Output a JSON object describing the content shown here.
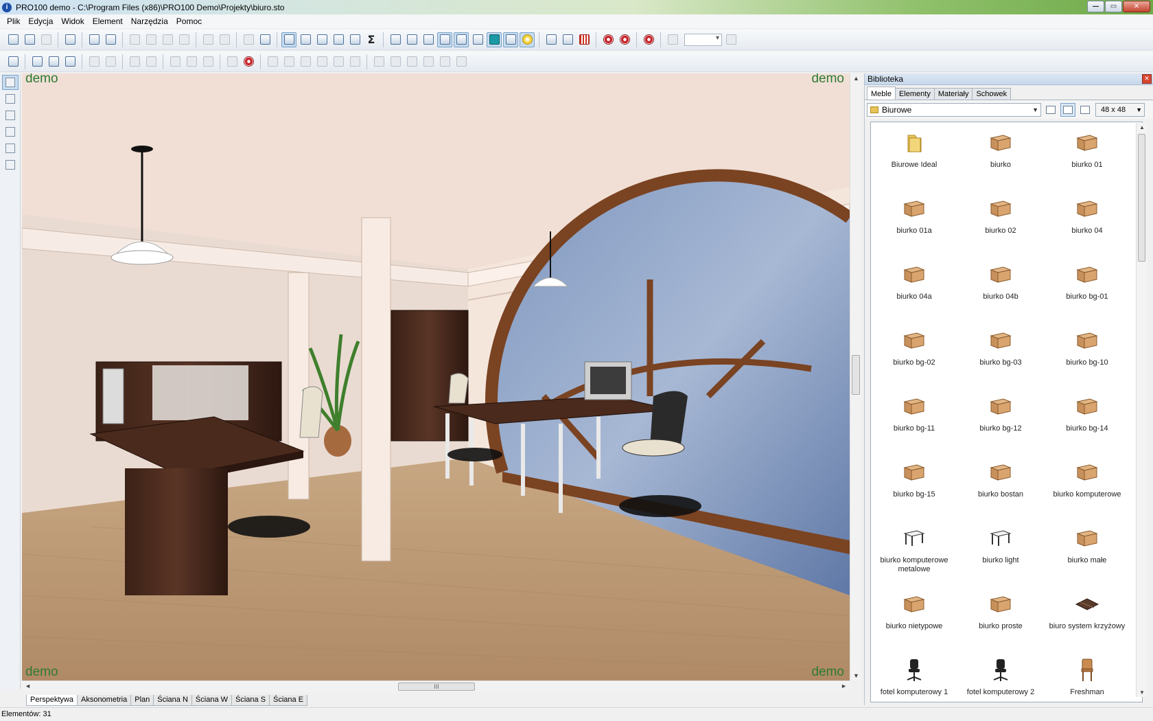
{
  "window": {
    "title": "PRO100 demo - C:\\Program Files (x86)\\PRO100 Demo\\Projekty\\biuro.sto",
    "app_icon_letter": "i",
    "controls": {
      "minimize": "—",
      "maximize": "▭",
      "close": "✕"
    }
  },
  "menu": [
    "Plik",
    "Edycja",
    "Widok",
    "Element",
    "Narzędzia",
    "Pomoc"
  ],
  "toolbar": {
    "sigma_label": "Σ"
  },
  "viewport": {
    "watermarks": [
      "demo",
      "demo",
      "demo",
      "demo"
    ],
    "scroll_grip": "III",
    "scroll_up": "▲",
    "scroll_down": "▼",
    "scroll_left": "◄",
    "scroll_right": "►"
  },
  "view_tabs": [
    {
      "label": "Perspektywa",
      "active": true
    },
    {
      "label": "Aksonometria",
      "active": false
    },
    {
      "label": "Plan",
      "active": false
    },
    {
      "label": "Ściana N",
      "active": false
    },
    {
      "label": "Ściana W",
      "active": false
    },
    {
      "label": "Ściana S",
      "active": false
    },
    {
      "label": "Ściana E",
      "active": false
    }
  ],
  "status": {
    "text": "Elementów: 31"
  },
  "library": {
    "title": "Biblioteka",
    "close": "✕",
    "tabs": [
      {
        "label": "Meble",
        "active": true
      },
      {
        "label": "Elementy",
        "active": false
      },
      {
        "label": "Materiały",
        "active": false
      },
      {
        "label": "Schowek",
        "active": false
      }
    ],
    "folder": "Biurowe",
    "thumb_size": "48 x 48",
    "dropdown_arrow": "▼",
    "items": [
      {
        "label": "Biurowe Ideal",
        "icon": "folder-icon"
      },
      {
        "label": "biurko",
        "icon": "desk-icon"
      },
      {
        "label": "biurko 01",
        "icon": "desk-icon"
      },
      {
        "label": "biurko 01a",
        "icon": "desk-icon"
      },
      {
        "label": "biurko 02",
        "icon": "desk-icon"
      },
      {
        "label": "biurko 04",
        "icon": "desk-icon"
      },
      {
        "label": "biurko 04a",
        "icon": "desk-icon"
      },
      {
        "label": "biurko 04b",
        "icon": "desk-icon"
      },
      {
        "label": "biurko bg-01",
        "icon": "desk-icon"
      },
      {
        "label": "biurko bg-02",
        "icon": "desk-icon"
      },
      {
        "label": "biurko bg-03",
        "icon": "desk-icon"
      },
      {
        "label": "biurko bg-10",
        "icon": "desk-icon"
      },
      {
        "label": "biurko bg-11",
        "icon": "desk-icon"
      },
      {
        "label": "biurko bg-12",
        "icon": "desk-icon"
      },
      {
        "label": "biurko bg-14",
        "icon": "desk-icon"
      },
      {
        "label": "biurko bg-15",
        "icon": "desk-icon"
      },
      {
        "label": "biurko bostan",
        "icon": "desk-icon"
      },
      {
        "label": "biurko komputerowe",
        "icon": "desk-icon"
      },
      {
        "label": "biurko komputerowe metalowe",
        "icon": "desk-metal-icon"
      },
      {
        "label": "biurko light",
        "icon": "desk-metal-icon"
      },
      {
        "label": "biurko małe",
        "icon": "desk-icon"
      },
      {
        "label": "biurko nietypowe",
        "icon": "desk-icon"
      },
      {
        "label": "biurko proste",
        "icon": "desk-icon"
      },
      {
        "label": "biuro system krzyżowy",
        "icon": "cross-desk-icon"
      },
      {
        "label": "fotel komputerowy 1",
        "icon": "chair-icon"
      },
      {
        "label": "fotel komputerowy 2",
        "icon": "chair-icon"
      },
      {
        "label": "Freshman",
        "icon": "chair-wood-icon"
      }
    ]
  }
}
